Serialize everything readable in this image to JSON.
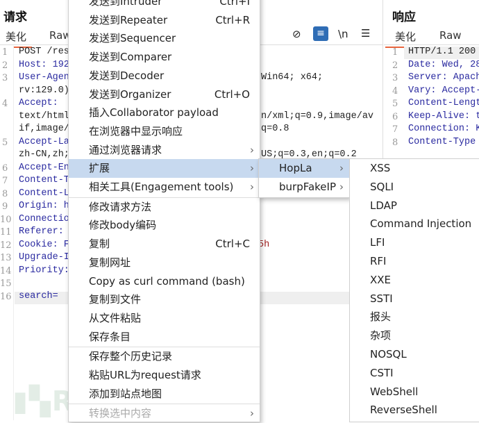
{
  "request": {
    "title": "请求",
    "tabs": [
      "美化",
      "Raw"
    ],
    "toolbar_icons": [
      "eye-slash-icon",
      "wrap-icon",
      "newline-icon",
      "menu-icon"
    ],
    "newline_label": "\\n",
    "lines": [
      {
        "n": "1",
        "text": "POST /res",
        "key": false
      },
      {
        "n": "2",
        "text": "Host: 192",
        "key": true
      },
      {
        "n": "3",
        "text": "User-Agen",
        "key": true,
        "tail": "Win64; x64;"
      },
      {
        "n": "",
        "text": "rv:129.0)"
      },
      {
        "n": "4",
        "text": "Accept:",
        "key": true
      },
      {
        "n": "",
        "text": "text/html",
        "tail": "n/xml;q=0.9,image/av"
      },
      {
        "n": "",
        "text": "if,image/",
        "tail": "q=0.8"
      },
      {
        "n": "5",
        "text": "Accept-La",
        "key": true
      },
      {
        "n": "",
        "text": "zh-CN,zh;",
        "tail": "US;q=0.3,en;q=0.2"
      },
      {
        "n": "6",
        "text": "Accept-En",
        "key": true
      },
      {
        "n": "7",
        "text": "Content-T",
        "key": true
      },
      {
        "n": "8",
        "text": "Content-L",
        "key": true
      },
      {
        "n": "9",
        "text": "Origin: h",
        "key": true
      },
      {
        "n": "10",
        "text": "Connectio",
        "key": true
      },
      {
        "n": "11",
        "text": "Referer:",
        "key": true
      },
      {
        "n": "12",
        "text": "Cookie: F",
        "key": true,
        "tail": "5h"
      },
      {
        "n": "13",
        "text": "Upgrade-I",
        "key": true
      },
      {
        "n": "14",
        "text": "Priority:",
        "key": true
      },
      {
        "n": "15",
        "text": ""
      },
      {
        "n": "16",
        "text": "search=",
        "key": true
      }
    ]
  },
  "response": {
    "title": "响应",
    "tabs": [
      "美化",
      "Raw"
    ],
    "lines": [
      {
        "n": "1",
        "text": "HTTP/1.1 200"
      },
      {
        "n": "2",
        "text": "Date: Wed, 28"
      },
      {
        "n": "3",
        "text": "Server: Apach"
      },
      {
        "n": "4",
        "text": "Vary: Accept-"
      },
      {
        "n": "5",
        "text": "Content-Lengt"
      },
      {
        "n": "6",
        "text": "Keep-Alive: t"
      },
      {
        "n": "7",
        "text": "Connection: K"
      },
      {
        "n": "8",
        "text": "Content-Type"
      }
    ]
  },
  "context_menu": {
    "items": [
      {
        "label": "发送到Intruder",
        "shortcut": "Ctrl+I"
      },
      {
        "label": "发送到Repeater",
        "shortcut": "Ctrl+R"
      },
      {
        "label": "发送到Sequencer"
      },
      {
        "label": "发送到Comparer"
      },
      {
        "label": "发送到Decoder"
      },
      {
        "label": "发送到Organizer",
        "shortcut": "Ctrl+O"
      },
      {
        "label": "插入Collaborator payload"
      },
      {
        "label": "在浏览器中显示响应"
      },
      {
        "label": "通过浏览器请求",
        "submenu": true
      },
      {
        "label": "扩展",
        "submenu": true,
        "selected": true
      },
      {
        "label": "相关工具(Engagement tools)",
        "submenu": true
      },
      {
        "label": "修改请求方法",
        "sep_before": true
      },
      {
        "label": "修改body编码"
      },
      {
        "label": "复制",
        "shortcut": "Ctrl+C"
      },
      {
        "label": "复制网址"
      },
      {
        "label": "Copy as curl command (bash)"
      },
      {
        "label": "复制到文件"
      },
      {
        "label": "从文件粘贴"
      },
      {
        "label": "保存条目"
      },
      {
        "label": "保存整个历史记录",
        "sep_before": true
      },
      {
        "label": "粘贴URL为request请求"
      },
      {
        "label": "添加到站点地图"
      },
      {
        "label": "转换选中内容",
        "submenu": true,
        "disabled": true,
        "sep_before": true
      }
    ]
  },
  "extensions_menu": {
    "items": [
      {
        "label": "HopLa",
        "selected": true
      },
      {
        "label": "burpFakeIP"
      }
    ]
  },
  "hopla_menu": {
    "items": [
      "XSS",
      "SQLI",
      "LDAP",
      "Command Injection",
      "LFI",
      "RFI",
      "XXE",
      "SSTI",
      "报头",
      "杂项",
      "NOSQL",
      "CSTI",
      "WebShell",
      "ReverseShell"
    ]
  },
  "watermark": "FREEBUF"
}
